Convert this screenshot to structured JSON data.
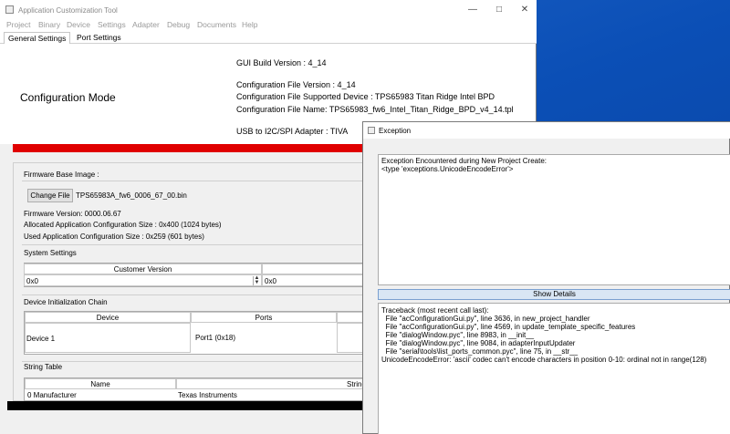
{
  "main_window": {
    "title": "Application Customization Tool",
    "menu": [
      "Project",
      "Binary",
      "Device",
      "Settings",
      "Adapter",
      "Debug",
      "Documents",
      "Help"
    ],
    "tabs": [
      "General Settings",
      "Port Settings"
    ],
    "mode_title": "Configuration Mode",
    "gui_build": "GUI Build Version : 4_14",
    "config_file_version": "Configuration File Version : 4_14",
    "supported_device": "Configuration File Supported Device : TPS65983 Titan Ridge Intel BPD",
    "config_file_name": "Configuration File Name: TPS65983_fw6_Intel_Titan_Ridge_BPD_v4_14.tpl",
    "adapter": "USB to I2C/SPI Adapter : TIVA",
    "firmware": {
      "section": "Firmware Base Image :",
      "change_file": "Change File",
      "file_name": "TPS65983A_fw6_0006_67_00.bin",
      "version": "Firmware Version:   0000.06.67",
      "alloc_size": "Allocated Application Configuration Size :   0x400 (1024 bytes)",
      "used_size": "Used Application Configuration Size :   0x259 (601 bytes)"
    },
    "system_settings": {
      "section": "System Settings",
      "customer_version_header": "Customer Version",
      "value_1": "0x0",
      "value_2": "0x0"
    },
    "device_init": {
      "section": "Device Initialization Chain",
      "headers": [
        "Device",
        "Ports"
      ],
      "row_device": "Device 1",
      "row_ports": "Port1 (0x18)"
    },
    "string_table": {
      "section": "String Table",
      "headers": [
        "Name",
        "String"
      ],
      "row_name": "0 Manufacturer",
      "row_string": "Texas Instruments"
    }
  },
  "exception_dialog": {
    "title": "Exception",
    "message_line1": "Exception Encountered during New Project Create:",
    "message_line2": "<type 'exceptions.UnicodeEncodeError'>",
    "show_details": "Show Details",
    "traceback": [
      "Traceback (most recent call last):",
      "  File \"acConfigurationGui.py\", line 3636, in new_project_handler",
      "  File \"acConfigurationGui.py\", line 4569, in update_template_specific_features",
      "  File \"dialogWindow.pyc\", line 8983, in __init__",
      "  File \"dialogWindow.pyc\", line 9084, in adapterInputUpdater",
      "  File \"serial\\tools\\list_ports_common.pyc\", line 75, in __str__",
      "UnicodeEncodeError: 'ascii' codec can't encode characters in position 0-10: ordinal not in range(128)"
    ]
  }
}
